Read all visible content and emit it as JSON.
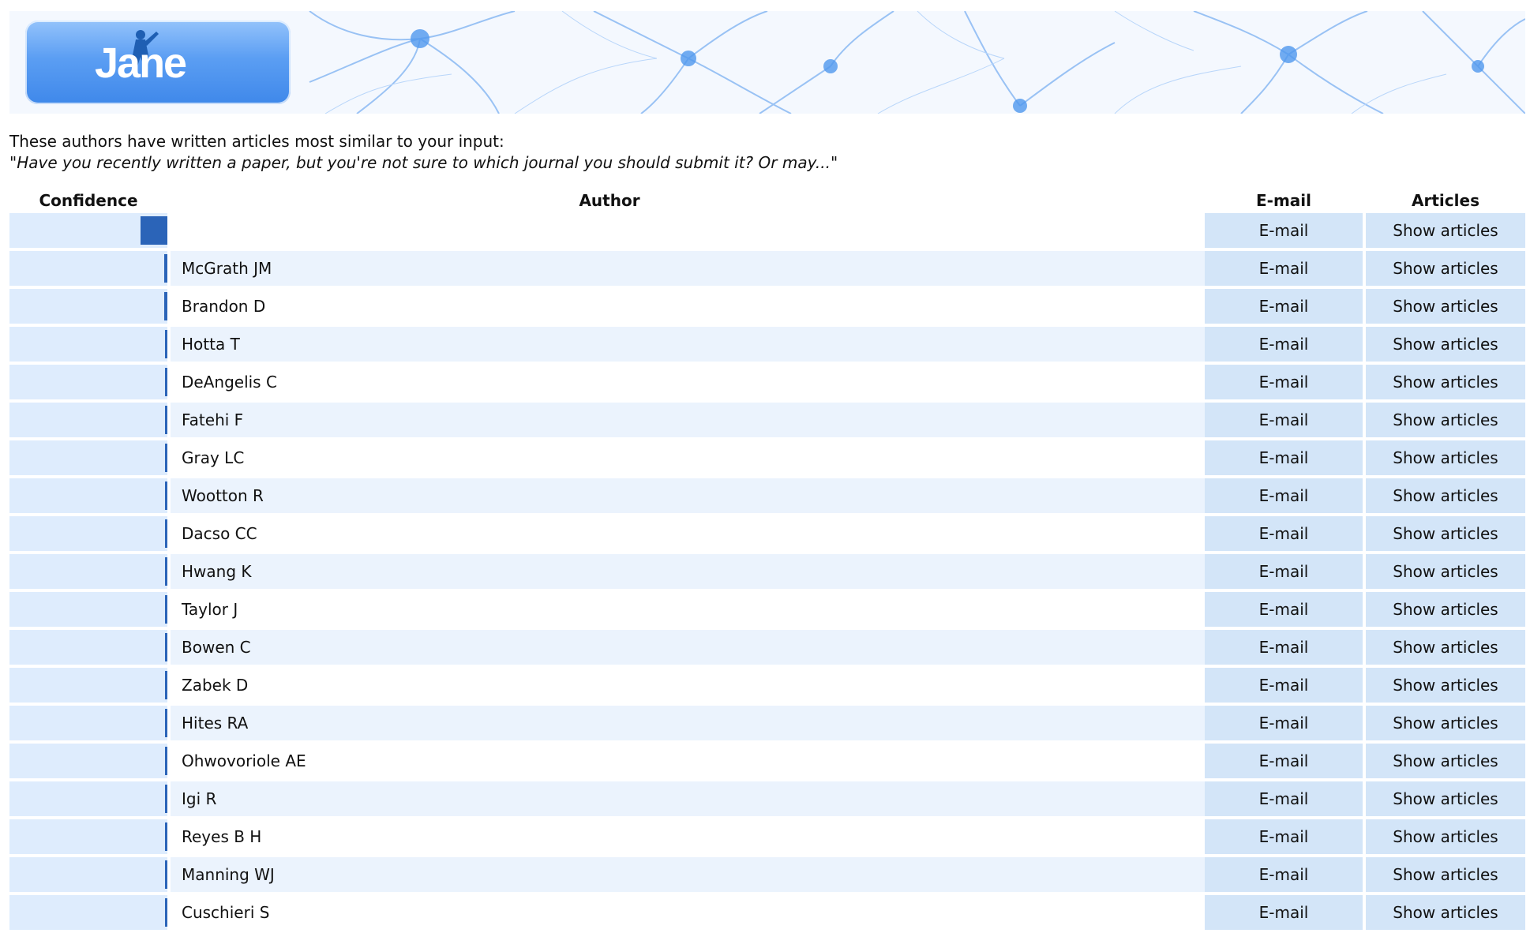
{
  "app": {
    "logo_text": "Jane",
    "colors": {
      "accent": "#2b64b8",
      "button_bg": "#d3e5f8",
      "confidence_bg": "#deecfd",
      "row_alt_bg": "#ebf3fd",
      "logo_blue": "#5b9ef3"
    },
    "icons": [
      "jane-logo-icon",
      "neuron-banner-image"
    ]
  },
  "intro": {
    "line1": "These authors have written articles most similar to your input:",
    "quote": "\"Have you recently written a paper, but you're not sure to which journal you should submit it? Or may...\""
  },
  "table": {
    "headers": {
      "confidence": "Confidence",
      "author": "Author",
      "email": "E-mail",
      "articles": "Articles"
    },
    "rows": [
      {
        "author": "",
        "confidence": 0.17,
        "email_label": "E-mail",
        "articles_label": "Show articles"
      },
      {
        "author": "McGrath JM",
        "confidence": 0.02,
        "email_label": "E-mail",
        "articles_label": "Show articles"
      },
      {
        "author": "Brandon D",
        "confidence": 0.02,
        "email_label": "E-mail",
        "articles_label": "Show articles"
      },
      {
        "author": "Hotta T",
        "confidence": 0.01,
        "email_label": "E-mail",
        "articles_label": "Show articles"
      },
      {
        "author": "DeAngelis C",
        "confidence": 0.01,
        "email_label": "E-mail",
        "articles_label": "Show articles"
      },
      {
        "author": "Fatehi F",
        "confidence": 0.01,
        "email_label": "E-mail",
        "articles_label": "Show articles"
      },
      {
        "author": "Gray LC",
        "confidence": 0.01,
        "email_label": "E-mail",
        "articles_label": "Show articles"
      },
      {
        "author": "Wootton R",
        "confidence": 0.01,
        "email_label": "E-mail",
        "articles_label": "Show articles"
      },
      {
        "author": "Dacso CC",
        "confidence": 0.01,
        "email_label": "E-mail",
        "articles_label": "Show articles"
      },
      {
        "author": "Hwang K",
        "confidence": 0.01,
        "email_label": "E-mail",
        "articles_label": "Show articles"
      },
      {
        "author": "Taylor J",
        "confidence": 0.01,
        "email_label": "E-mail",
        "articles_label": "Show articles"
      },
      {
        "author": "Bowen C",
        "confidence": 0.01,
        "email_label": "E-mail",
        "articles_label": "Show articles"
      },
      {
        "author": "Zabek D",
        "confidence": 0.01,
        "email_label": "E-mail",
        "articles_label": "Show articles"
      },
      {
        "author": "Hites RA",
        "confidence": 0.01,
        "email_label": "E-mail",
        "articles_label": "Show articles"
      },
      {
        "author": "Ohwovoriole AE",
        "confidence": 0.01,
        "email_label": "E-mail",
        "articles_label": "Show articles"
      },
      {
        "author": "Igi R",
        "confidence": 0.01,
        "email_label": "E-mail",
        "articles_label": "Show articles"
      },
      {
        "author": "Reyes B H",
        "confidence": 0.01,
        "email_label": "E-mail",
        "articles_label": "Show articles"
      },
      {
        "author": "Manning WJ",
        "confidence": 0.01,
        "email_label": "E-mail",
        "articles_label": "Show articles"
      },
      {
        "author": "Cuschieri S",
        "confidence": 0.01,
        "email_label": "E-mail",
        "articles_label": "Show articles"
      }
    ]
  }
}
